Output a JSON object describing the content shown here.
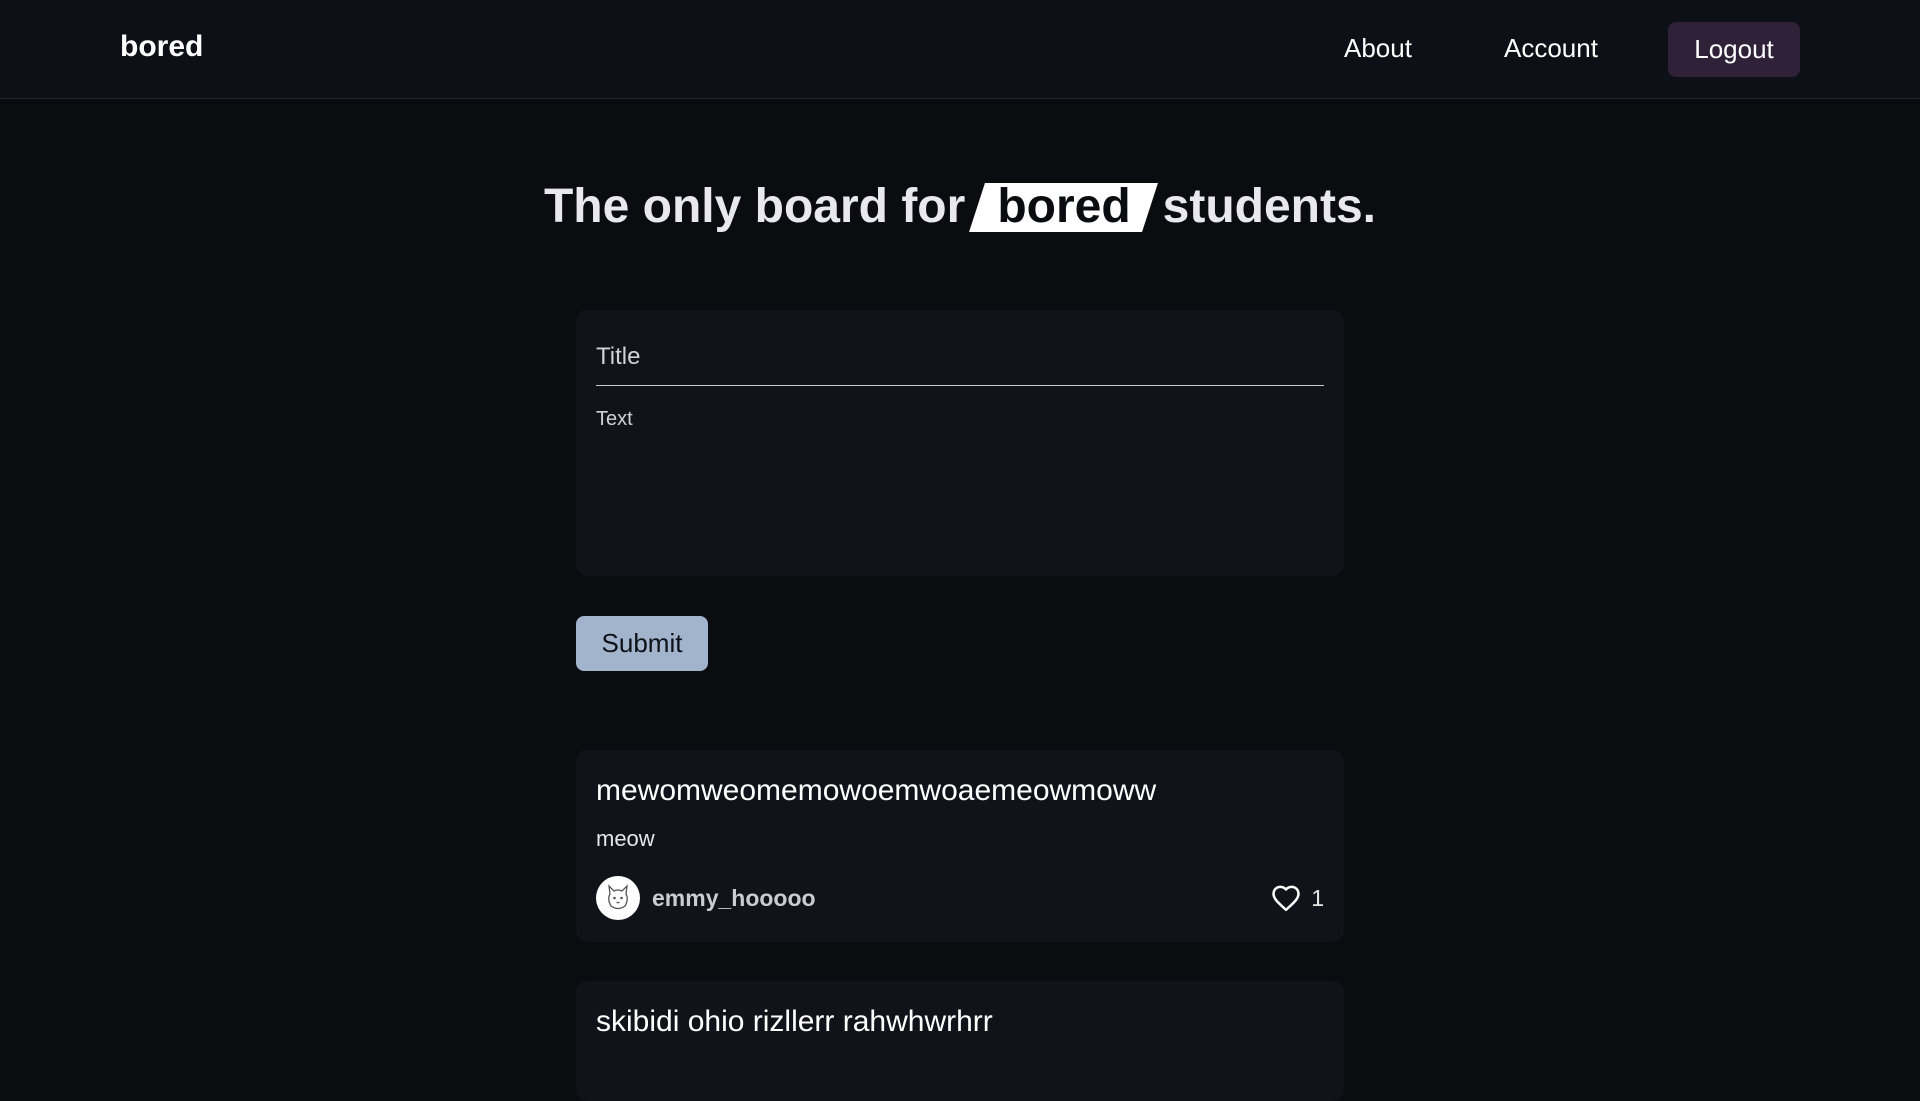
{
  "header": {
    "brand": "bored",
    "nav": {
      "about": "About",
      "account": "Account",
      "logout": "Logout"
    }
  },
  "hero": {
    "before": "The only board for",
    "highlight": "bored",
    "after": "students."
  },
  "form": {
    "title_placeholder": "Title",
    "text_placeholder": "Text",
    "submit_label": "Submit"
  },
  "posts": [
    {
      "title": "mewomweomemowoemwoaemeowmoww",
      "body": "meow",
      "author": "emmy_hooooo",
      "likes": "1",
      "avatar_icon": "cat-avatar-icon",
      "like_icon": "heart-outline-icon"
    },
    {
      "title": "skibidi ohio rizllerr rahwhwrhrr"
    }
  ]
}
